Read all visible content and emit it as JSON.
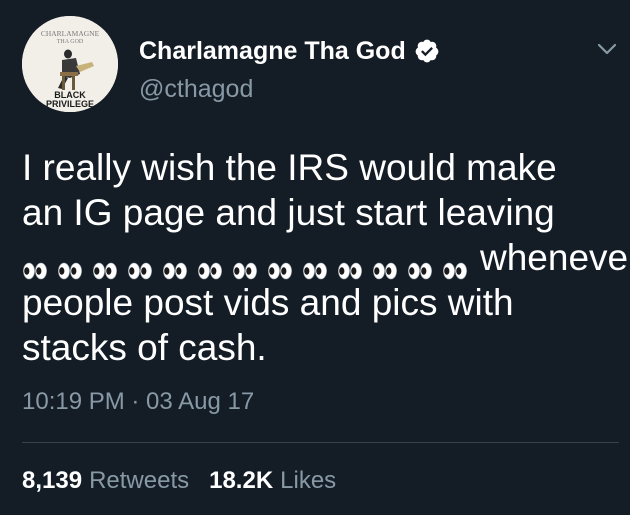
{
  "user": {
    "display_name": "Charlamagne Tha God",
    "handle": "@cthagod",
    "verified": true,
    "avatar": {
      "book_author_lines": [
        "CHARLAMAGNE",
        "THA GOD"
      ],
      "book_title_lines": [
        "BLACK",
        "PRIVILEGE"
      ]
    }
  },
  "tweet": {
    "lines": [
      "I really wish the IRS would make",
      "an IG page and just start leaving",
      "whenever",
      "people post vids and pics with",
      "stacks of cash."
    ],
    "emoji_name": "eyes",
    "emoji_count": 13,
    "timestamp": "10:19 PM · 03 Aug 17"
  },
  "stats": {
    "retweets_count": "8,139",
    "retweets_label": "Retweets",
    "likes_count": "18.2K",
    "likes_label": "Likes"
  },
  "colors": {
    "background": "#141d26",
    "text_primary": "#ffffff",
    "text_secondary": "#8899a6",
    "divider": "#38444d",
    "verified_badge": "#ffffff"
  },
  "icons": {
    "verified": "verified-badge-icon",
    "menu": "chevron-down-icon",
    "emoji": "eyes-emoji"
  }
}
